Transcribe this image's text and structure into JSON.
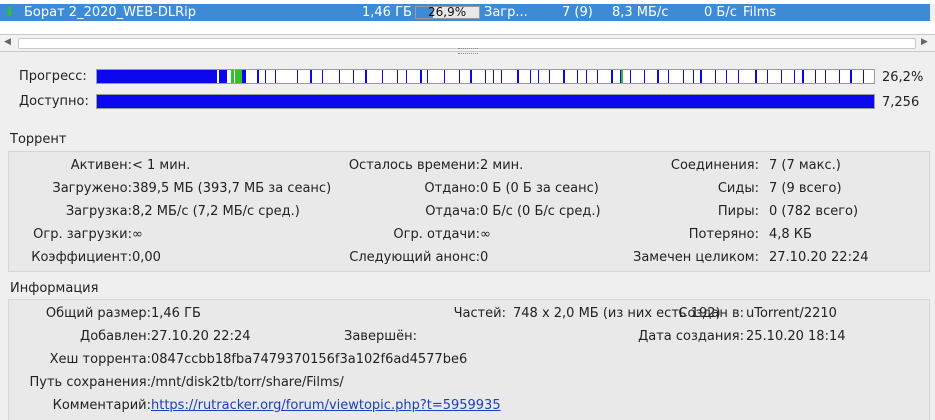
{
  "torrent_list": {
    "selected_row": {
      "name": "Борат 2_2020_WEB-DLRip",
      "size": "1,46 ГБ",
      "progress": "26,9%",
      "progress_fraction": 0.269,
      "status": "Загр...",
      "seeds": "7 (9)",
      "down_speed": "8,3 МБ/с",
      "up_speed": "0 Б/с",
      "category": "Films"
    }
  },
  "bars": {
    "progress_label": "Прогресс:",
    "progress_value": "26,2%",
    "progress_fraction": 0.262,
    "available_label": "Доступно:",
    "available_value": "7,256"
  },
  "torrent": {
    "title": "Торрент",
    "col1": [
      {
        "label": "Активен:",
        "value": "< 1 мин."
      },
      {
        "label": "Загружено:",
        "value": "389,5 МБ (393,7 МБ за сеанс)"
      },
      {
        "label": "Загрузка:",
        "value": "8,2 МБ/с (7,2 МБ/с сред.)"
      },
      {
        "label": "Огр. загрузки:",
        "value": "∞"
      },
      {
        "label": "Коэффициент:",
        "value": "0,00"
      }
    ],
    "col2": [
      {
        "label": "Осталось времени:",
        "value": "2 мин."
      },
      {
        "label": "Отдано:",
        "value": "0 Б (0 Б за сеанс)"
      },
      {
        "label": "Отдача:",
        "value": "0 Б/с (0 Б/с сред.)"
      },
      {
        "label": "Огр. отдачи:",
        "value": "∞"
      },
      {
        "label": "Следующий анонс:",
        "value": "0"
      }
    ],
    "col3": [
      {
        "label": "Соединения:",
        "value": "7 (7 макс.)"
      },
      {
        "label": "Сиды:",
        "value": "7 (9 всего)"
      },
      {
        "label": "Пиры:",
        "value": "0 (782 всего)"
      },
      {
        "label": "Потеряно:",
        "value": "4,8 КБ"
      },
      {
        "label": "Замечен целиком:",
        "value": "27.10.20 22:24"
      }
    ]
  },
  "info": {
    "title": "Информация",
    "total_size_label": "Общий размер:",
    "total_size": "1,46 ГБ",
    "pieces_label": "Частей:",
    "pieces": "748 x 2,0 МБ (из них есть 192)",
    "created_by_label": "Создан в:",
    "created_by": "uTorrent/2210",
    "added_label": "Добавлен:",
    "added": "27.10.20 22:24",
    "completed_label": "Завершён:",
    "completed": "",
    "creation_date_label": "Дата создания:",
    "creation_date": "25.10.20 18:14",
    "hash_label": "Хеш торрента:",
    "hash": "0847ccbb18fba7479370156f3a102f6ad4577be6",
    "save_path_label": "Путь сохранения:",
    "save_path": "/mnt/disk2tb/torr/share/Films/",
    "comment_label": "Комментарий:",
    "comment": "https://rutracker.org/forum/viewtopic.php?t=5959935"
  },
  "colors": {
    "selection": "#3d8bd6",
    "progress_blue": "#0a07ee",
    "downloading_green": "#2fc12f",
    "link": "#1a3fbf"
  },
  "icons": {
    "status_icon": "download-arrow-icon"
  }
}
